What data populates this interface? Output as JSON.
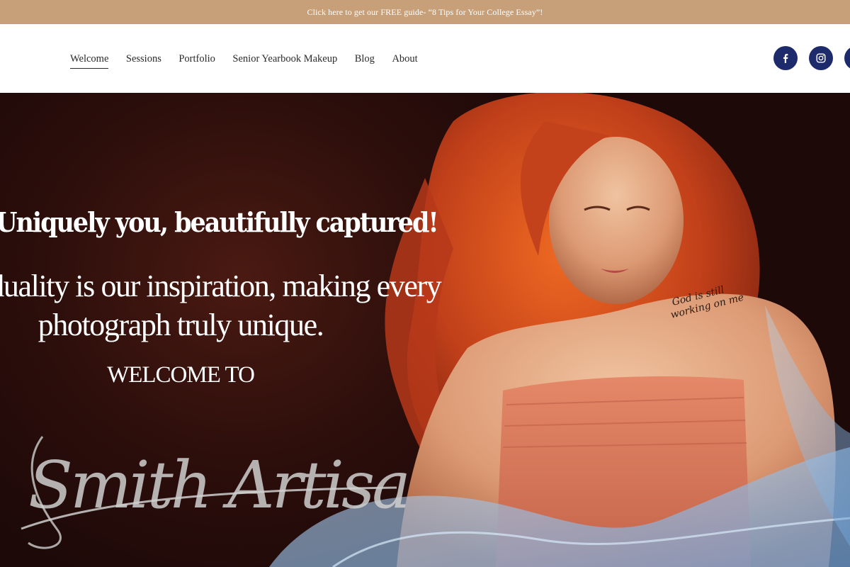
{
  "announcement": {
    "text": "Click here to get our FREE guide- “8 Tips for Your College Essay”!"
  },
  "nav": {
    "items": [
      {
        "label": "Welcome",
        "active": true
      },
      {
        "label": "Sessions",
        "active": false
      },
      {
        "label": "Portfolio",
        "active": false
      },
      {
        "label": "Senior Yearbook Makeup",
        "active": false
      },
      {
        "label": "Blog",
        "active": false
      },
      {
        "label": "About",
        "active": false
      }
    ]
  },
  "social": {
    "icons": [
      "facebook-icon",
      "instagram-icon",
      "social-icon"
    ],
    "color": "#1d2a6b"
  },
  "hero": {
    "title": "Uniquely you, beautifully captured!",
    "subtitle_line1": "Individuality is our inspiration, making every",
    "subtitle_line2": "photograph truly unique.",
    "welcome": "WELCOME TO",
    "logo_text": "Smith Artisan",
    "tattoo_text": "God is still working on me"
  },
  "colors": {
    "announcement_bg": "#c7a07a",
    "hero_bg": "#2c0e0b",
    "hair": "#c8461c",
    "dress": "#d8785a",
    "tulle": "#9fc3e6"
  }
}
